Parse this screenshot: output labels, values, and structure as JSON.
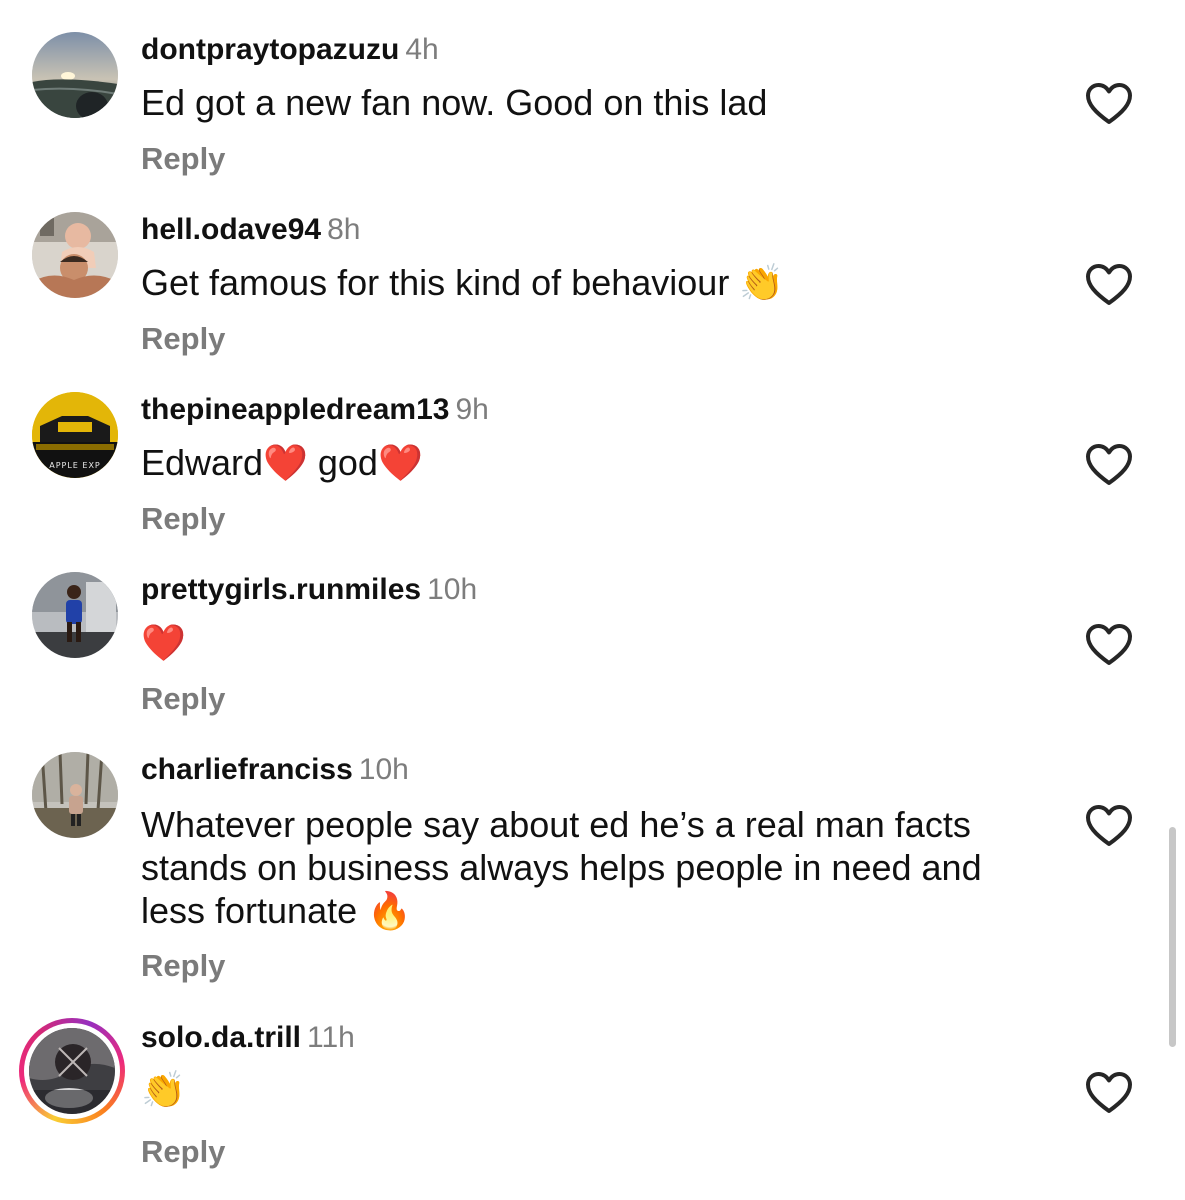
{
  "comments": [
    {
      "username": "dontpraytopazuzu",
      "time": "4h",
      "text": "Ed got a new fan now. Good on this lad",
      "emoji": "",
      "reply": "Reply",
      "like_icon": "heart-outline-icon"
    },
    {
      "username": "hell.odave94",
      "time": "8h",
      "text": "Get famous for this kind of behaviour",
      "emoji": "👏",
      "reply": "Reply",
      "like_icon": "heart-outline-icon"
    },
    {
      "username": "thepineappledream13",
      "time": "9h",
      "text_parts": [
        "Edward",
        "❤️",
        " god",
        "❤️"
      ],
      "reply": "Reply",
      "avatar_text": "APPLE EXP",
      "like_icon": "heart-outline-icon"
    },
    {
      "username": "prettygirls.runmiles",
      "time": "10h",
      "text": "",
      "emoji": "❤️",
      "reply": "Reply",
      "like_icon": "heart-outline-icon"
    },
    {
      "username": "charliefranciss",
      "time": "10h",
      "text": "Whatever people say about ed he’s a real man facts stands on business always helps people in need and less fortunate",
      "emoji": "🔥",
      "reply": "Reply",
      "like_icon": "heart-outline-icon"
    },
    {
      "username": "solo.da.trill",
      "time": "11h",
      "text": "",
      "emoji": "👏",
      "reply": "Reply",
      "has_story": true,
      "like_icon": "heart-outline-icon"
    }
  ],
  "colors": {
    "username": "#111111",
    "timestamp": "#7d7d7d",
    "reply": "#7b7b7b",
    "heart_outline": "#262626",
    "story_ring": [
      "#f9ce34",
      "#ee2a7b",
      "#962fbf"
    ]
  }
}
